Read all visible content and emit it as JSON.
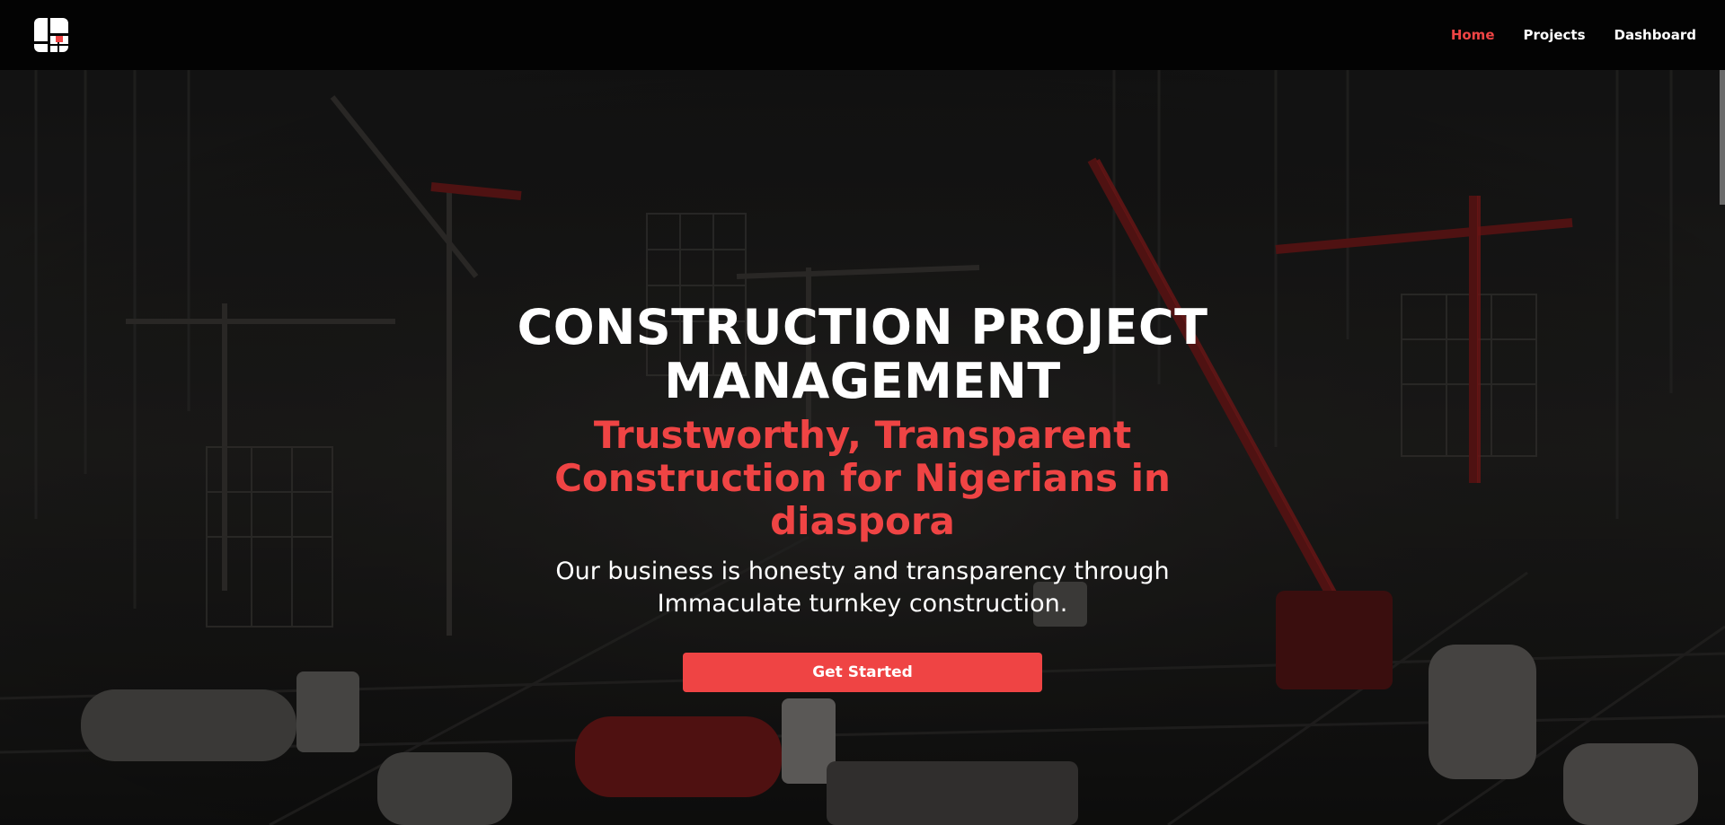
{
  "nav": {
    "links": [
      {
        "label": "Home",
        "active": true
      },
      {
        "label": "Projects",
        "active": false
      },
      {
        "label": "Dashboard",
        "active": false
      }
    ]
  },
  "hero": {
    "title": "CONSTRUCTION PROJECT MANAGEMENT",
    "subtitle": "Trustworthy, Transparent Construction for Nigerians in diaspora",
    "description": "Our business is honesty and transparency through Immaculate turnkey construction.",
    "cta_label": "Get Started"
  },
  "colors": {
    "accent": "#ef4444",
    "navbar": "#030303",
    "text": "#ffffff"
  },
  "icons": {
    "logo": "building-logo-icon"
  }
}
